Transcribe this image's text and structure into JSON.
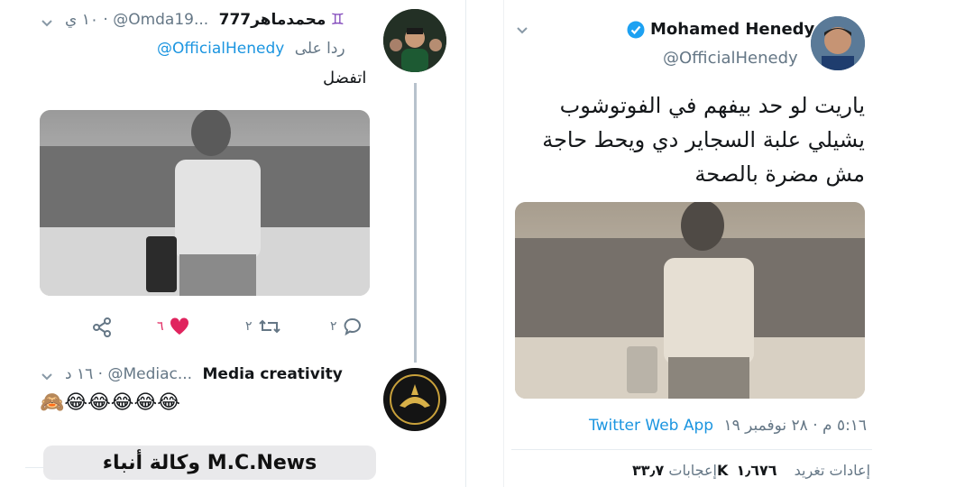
{
  "left": {
    "tweet1": {
      "display_name": "محمدماهر777",
      "badge": "♊",
      "handle": "@Omda19...",
      "time": "١٠ ي",
      "reply_prefix": "ردا على",
      "reply_to": "@OfficialHenedy",
      "text": "اتفضل",
      "actions": {
        "reply_count": "٢",
        "retweet_count": "٢",
        "like_count": "٦"
      }
    },
    "tweet2": {
      "display_name": "Media creativity",
      "handle": "@Mediac...",
      "time": "١٦ د",
      "text": "🙈😂😂😂😂😂"
    },
    "watermark": "وكالة أنباء M.C.News"
  },
  "right": {
    "display_name": "Mohamed Henedy",
    "handle": "@OfficialHenedy",
    "text_lines": [
      "ياريت لو حد بيفهم في الفوتوشوب",
      "يشيلي علبة السجاير دي ويحط حاجة",
      "مش مضرة بالصحة"
    ],
    "meta_time": "٥:١٦ م · ٢٨ نوفمبر ١٩",
    "meta_source": "Twitter Web App",
    "retweets_count": "١٫٦٧٦",
    "retweets_label": "إعادات تغريد",
    "likes_count": "٣٣٫٧K",
    "likes_label": "إعجابات"
  },
  "colors": {
    "link": "#1b95e0",
    "muted": "#657786",
    "heart": "#e0245e",
    "verified": "#1da1f2"
  }
}
